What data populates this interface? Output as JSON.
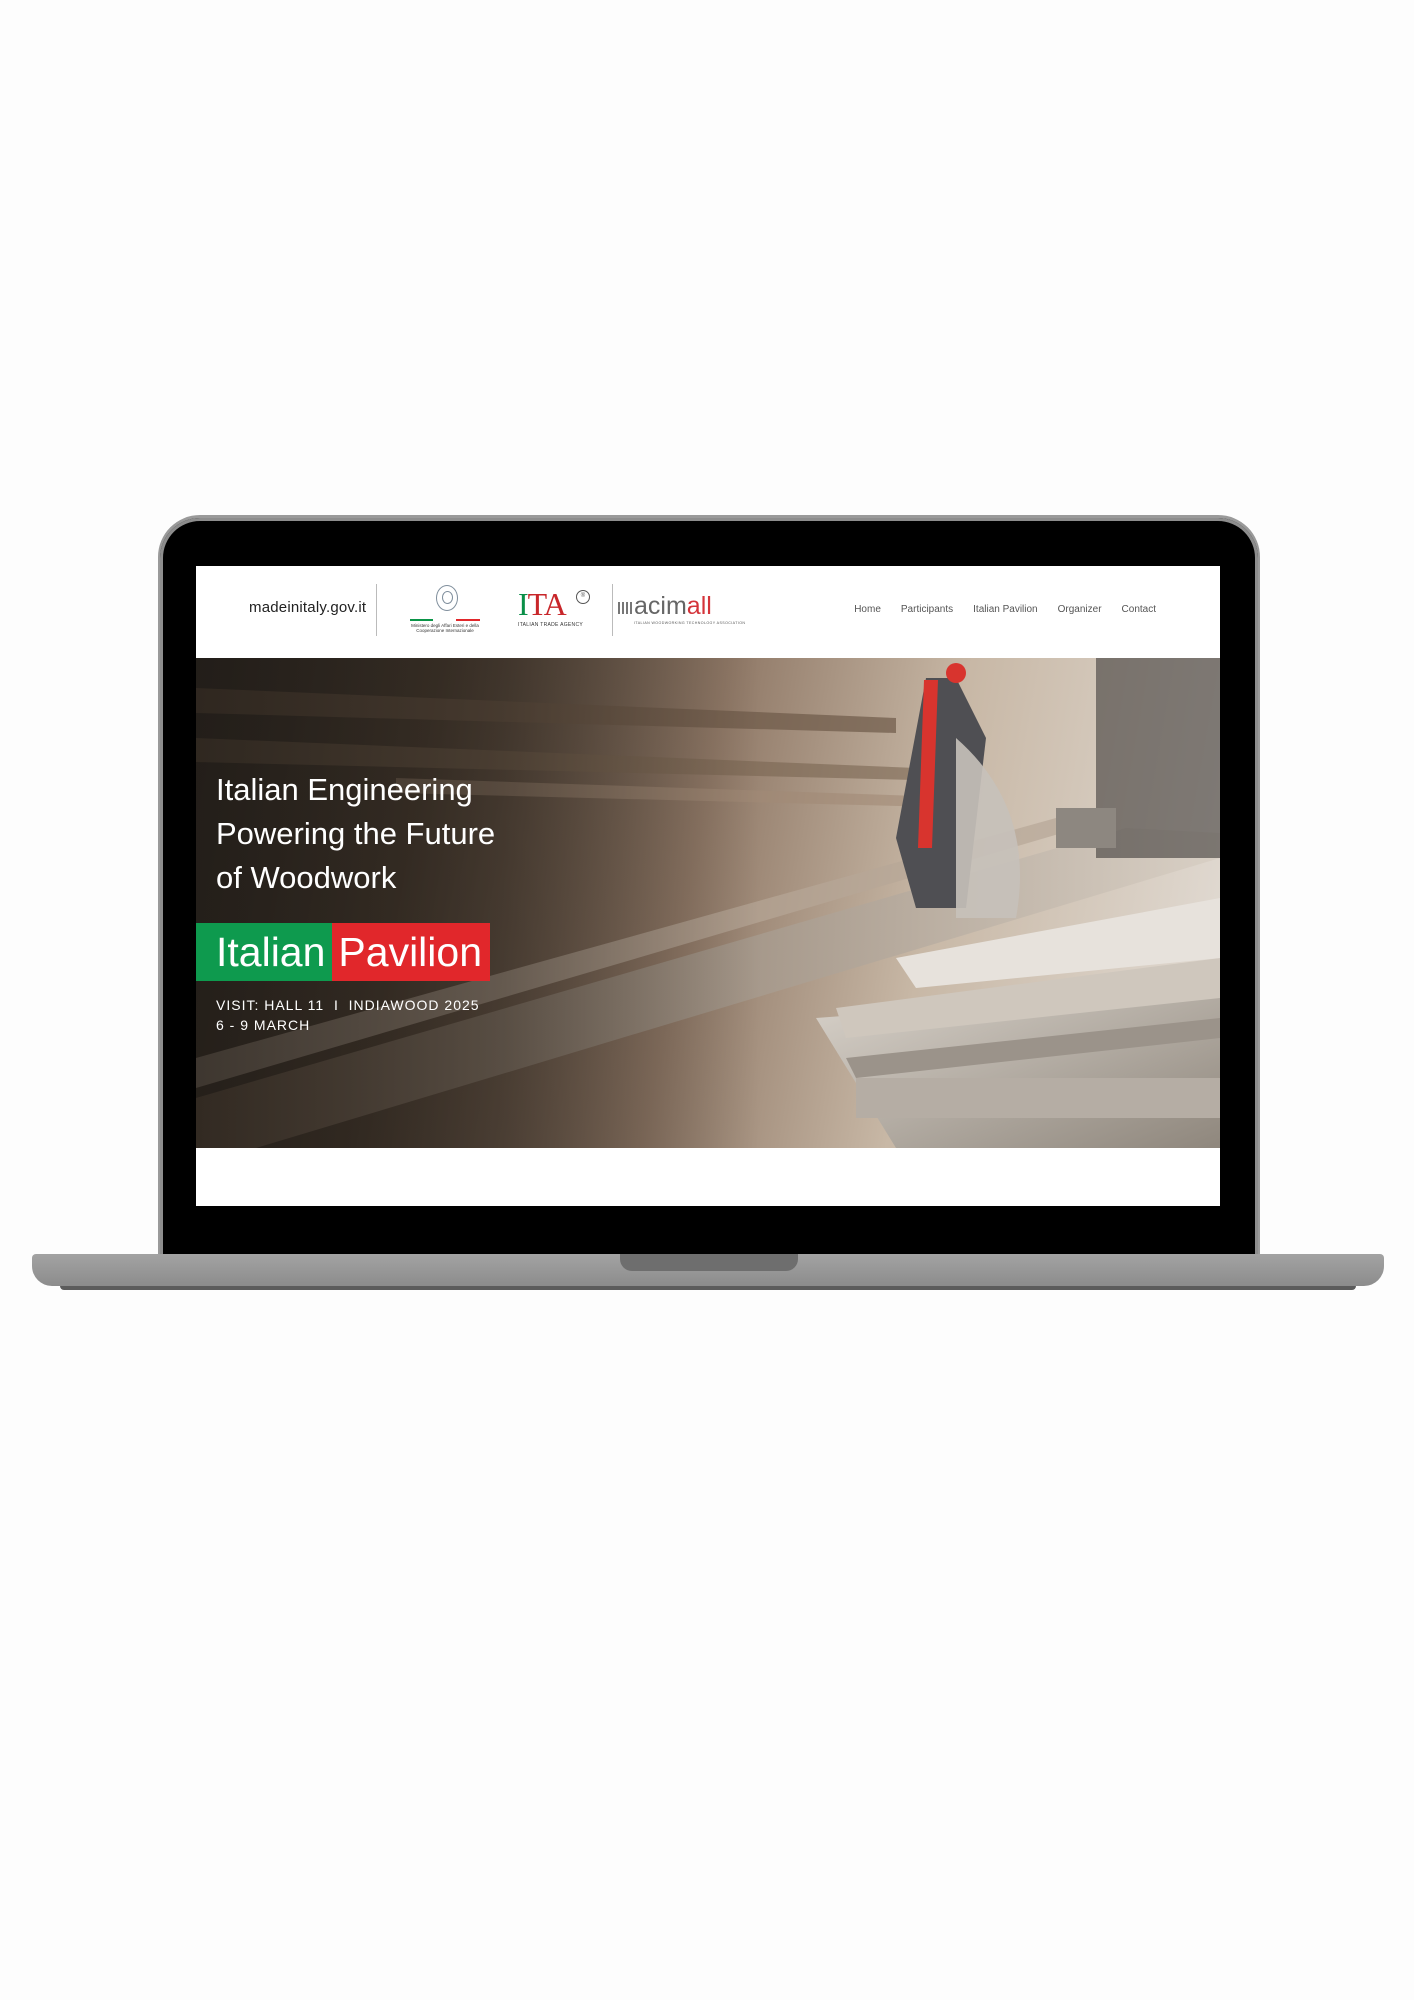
{
  "header": {
    "brand": "madeinitaly.gov.it",
    "ministry_text": "Ministero degli Affari Esteri e della Cooperazione Internazionale",
    "ita_letters": {
      "i": "I",
      "t": "T",
      "a": "A"
    },
    "ita_subtitle": "ITALIAN TRADE AGENCY",
    "acimall": {
      "prefix": "acim",
      "suffix": "all",
      "subtitle": "ITALIAN WOODWORKING TECHNOLOGY ASSOCIATION"
    },
    "nav": [
      "Home",
      "Participants",
      "Italian Pavilion",
      "Organizer",
      "Contact"
    ]
  },
  "hero": {
    "heading_lines": [
      "Italian Engineering",
      "Powering the Future",
      "of Woodwork"
    ],
    "badge_green": "Italian",
    "badge_red": "Pavilion",
    "visit_line": "VISIT: HALL 11  I  INDIAWOOD 2025",
    "date_line": "6 - 9 MARCH"
  },
  "colors": {
    "italy_green": "#0e9a4e",
    "italy_red": "#e1272b",
    "laptop_frame": "#000000",
    "laptop_base": "#9a9a9a"
  }
}
